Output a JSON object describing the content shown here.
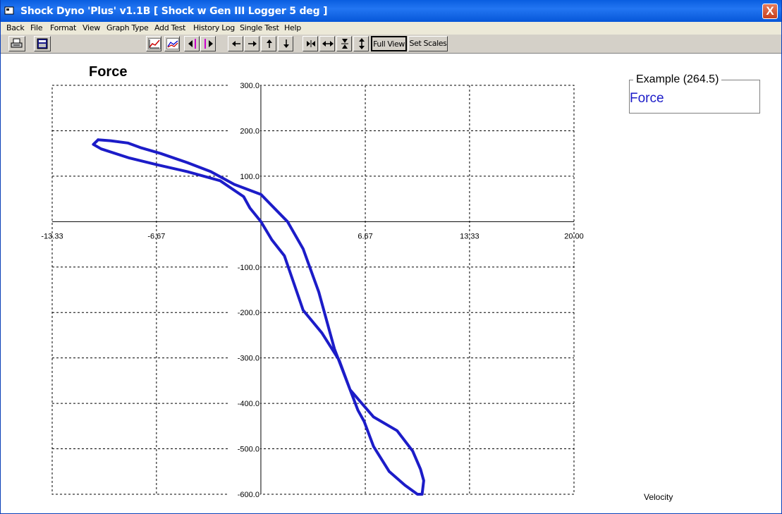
{
  "window": {
    "title": "Shock Dyno 'Plus' v1.1B  [ Shock w Gen III Logger 5 deg ]",
    "close_label": "X"
  },
  "menu": [
    "Back",
    "File",
    "Format",
    "View",
    "Graph Type",
    "Add Test",
    "History Log",
    "Single Test",
    "Help"
  ],
  "toolbar": {
    "icons": [
      "print-icon",
      "save-screen-icon",
      "plot-test-icon",
      "overlay-plot-icon",
      "prev-test-icon",
      "next-test-icon",
      "pan-left-icon",
      "pan-right-icon",
      "pan-up-icon",
      "pan-down-icon",
      "zoom-in-horizontal-icon",
      "zoom-out-horizontal-icon",
      "zoom-in-vertical-icon",
      "zoom-out-vertical-icon"
    ],
    "full_view_label": "Full View",
    "set_scales_label": "Set Scales"
  },
  "legend": {
    "title": "Example (264.5)",
    "series_label": "Force",
    "series_color": "#1c1cc8"
  },
  "chart_data": {
    "type": "line",
    "title": "Force",
    "xlabel": "Velocity",
    "ylabel": "",
    "xlim": [
      -13.33,
      20.0
    ],
    "ylim": [
      -600,
      300
    ],
    "x_ticks": [
      "-13.33",
      "-6.67",
      "6.67",
      "13.33",
      "20.00"
    ],
    "x_tick_values": [
      -13.33,
      -6.67,
      6.67,
      13.33,
      20.0
    ],
    "y_ticks": [
      "300.0",
      "200.0",
      "100.0",
      "-100.0",
      "-200.0",
      "-300.0",
      "-400.0",
      "-500.0",
      "-600.0"
    ],
    "y_tick_values": [
      300,
      200,
      100,
      -100,
      -200,
      -300,
      -400,
      -500,
      -600
    ],
    "grid": true,
    "series": [
      {
        "name": "Force",
        "color": "#1c1cc8",
        "x": [
          -10.4,
          -9.6,
          -8.5,
          -7.7,
          -6.4,
          -4.7,
          -3.2,
          -1.7,
          0.0,
          1.7,
          2.7,
          3.7,
          4.7,
          5.7,
          7.2,
          8.7,
          9.7,
          10.2,
          10.4,
          10.3,
          10.0,
          9.2,
          8.2,
          7.2,
          6.6,
          6.2,
          5.7,
          5.0,
          3.9,
          2.7,
          1.5,
          0.7,
          0.0,
          -0.7,
          -1.1,
          -2.6,
          -4.7,
          -6.6,
          -8.4,
          -10.2,
          -10.7,
          -10.4
        ],
        "y": [
          180,
          178,
          173,
          163,
          150,
          130,
          110,
          82,
          60,
          0,
          -60,
          -155,
          -280,
          -370,
          -430,
          -460,
          -505,
          -545,
          -570,
          -600,
          -600,
          -580,
          -550,
          -495,
          -440,
          -415,
          -370,
          -305,
          -245,
          -195,
          -75,
          -40,
          0,
          30,
          55,
          90,
          110,
          125,
          140,
          160,
          170,
          180
        ]
      }
    ]
  }
}
